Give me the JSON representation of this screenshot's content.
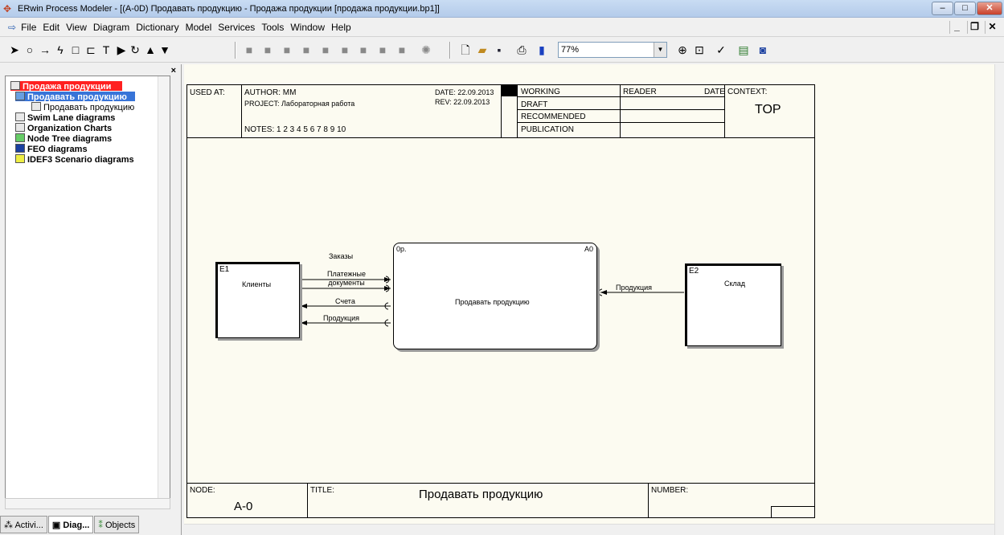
{
  "window": {
    "title": "ERwin Process Modeler - [(A-0D) Продавать продукцию - Продажа продукции  [продажа продукции.bp1]]"
  },
  "menu": [
    "File",
    "Edit",
    "View",
    "Diagram",
    "Dictionary",
    "Model",
    "Services",
    "Tools",
    "Window",
    "Help"
  ],
  "toolbar": {
    "zoom": "77%"
  },
  "tree": {
    "items": [
      {
        "label": "Продажа продукции",
        "level": 0,
        "icon": "model-icon",
        "selected_root": true
      },
      {
        "label": "Продавать продукцию",
        "level": 1,
        "icon": "activity-icon",
        "highlighted": true
      },
      {
        "label": "Продавать продукцию",
        "level": 2,
        "icon": "diagram-icon"
      },
      {
        "label": "Swim Lane diagrams",
        "level": 1,
        "icon": "swimlane-icon",
        "bold": true
      },
      {
        "label": "Organization Charts",
        "level": 1,
        "icon": "orgchart-icon",
        "bold": true
      },
      {
        "label": "Node Tree diagrams",
        "level": 1,
        "icon": "nodetree-icon",
        "bold": true
      },
      {
        "label": "FEO diagrams",
        "level": 1,
        "icon": "feo-icon",
        "bold": true
      },
      {
        "label": "IDEF3 Scenario diagrams",
        "level": 1,
        "icon": "idef3-icon",
        "bold": true
      }
    ]
  },
  "panel_tabs": [
    "Activi...",
    "Diag...",
    "Objects"
  ],
  "header": {
    "used_at": "USED AT:",
    "author": "AUTHOR:  MM",
    "project": "PROJECT:  Лабораторная работа",
    "notes": "NOTES:  1  2  3  4  5  6  7  8  9  10",
    "date": "DATE:  22.09.2013",
    "rev": "REV:  22.09.2013",
    "status": [
      "WORKING",
      "DRAFT",
      "RECOMMENDED",
      "PUBLICATION"
    ],
    "reader": "READER",
    "date2": "DATE",
    "context": "CONTEXT:",
    "context_value": "TOP"
  },
  "footer": {
    "node_label": "NODE:",
    "node_value": "A-0",
    "title_label": "TITLE:",
    "title_value": "Продавать продукцию",
    "number_label": "NUMBER:"
  },
  "diagram": {
    "external1": {
      "id": "E1",
      "name": "Клиенты"
    },
    "activity": {
      "cost": "0р.",
      "id": "A0",
      "name": "Продавать продукцию"
    },
    "external2": {
      "id": "E2",
      "name": "Склад"
    },
    "arrows": [
      "Заказы",
      "Платежные документы",
      "Счета",
      "Продукция",
      "Продукция"
    ]
  }
}
